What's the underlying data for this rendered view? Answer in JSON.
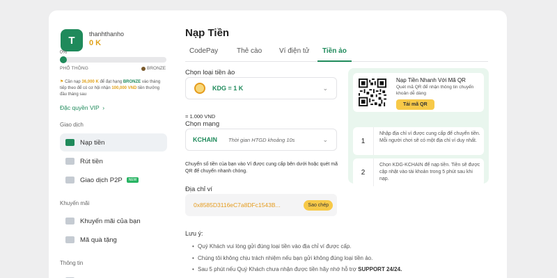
{
  "sidebar": {
    "avatar_letter": "T",
    "username": "thanhthanho",
    "balance": "0 K",
    "progress_label": "0%",
    "progress_value": 0,
    "rank_current": "PHỔ THÔNG",
    "rank_next": "BRONZE",
    "note": {
      "part1": "Cần nạp ",
      "amount": "36,000 K",
      "part2": " để đạt hạng ",
      "rank": "BRONZE",
      "part3": " vào tháng tiếp theo để có cơ hội nhận ",
      "reward": "100,000 VND",
      "part4": " tiền thưởng đầu tháng sau"
    },
    "vip_link": "Đặc quyền VIP",
    "sections": {
      "transactions": "Giao dịch",
      "promotions": "Khuyến mãi",
      "info": "Thông tin"
    },
    "items": {
      "deposit": "Nạp tiền",
      "withdraw": "Rút tiền",
      "p2p": "Giao dịch P2P",
      "p2p_badge": "NEW",
      "my_promos": "Khuyến mãi của bạn",
      "gift_code": "Mã quà tặng"
    }
  },
  "main": {
    "title": "Nạp Tiền",
    "tabs": [
      "CodePay",
      "Thẻ cào",
      "Ví điện tử",
      "Tiền ảo"
    ],
    "active_tab": "Tiền ảo",
    "currency_label": "Chọn loại tiền ảo",
    "currency_value": "KDG = 1 K",
    "rate": "= 1.000 VND",
    "network_label": "Chọn mạng",
    "network_value": "KCHAIN",
    "network_time": "Thời gian HTGD khoảng 10s",
    "instruction": "Chuyển số tiền của bạn vào Ví được cung cấp bên dưới hoặc quét mã QR để chuyển nhanh chóng.",
    "address_label": "Địa chỉ ví",
    "address_value": "0x8585D3116eC7a8DFc1543B...",
    "copy_label": "Sao chép",
    "notes_title": "Lưu ý:",
    "notes": [
      "Quý Khách vui lòng gửi đúng loại tiền vào địa chỉ ví được cấp.",
      "Chúng tôi không chịu trách nhiệm nếu bạn gửi không đúng loại tiền ảo.",
      "Sau 5 phút nếu Quý Khách chưa nhận được tiền hãy nhớ hỗ trợ "
    ],
    "support_text": "SUPPORT 24/24."
  },
  "qr_panel": {
    "title": "Nạp Tiền Nhanh Với Mã QR",
    "description": "Quét mã QR để nhận thông tin chuyển khoản dễ dàng",
    "download_label": "Tải mã QR",
    "steps": [
      {
        "num": "1",
        "text": "Nhập địa chỉ ví được cung cấp để chuyển tiền. Mỗi người chơi sẽ có một địa chỉ ví duy nhất."
      },
      {
        "num": "2",
        "text": "Chọn KDG-KCHAIN để nạp tiền. Tiền sẽ được cập nhật vào tài khoản trong 5 phút sau khi nạp."
      }
    ]
  },
  "colors": {
    "accent": "#1f8a5b",
    "gold": "#e0a21b",
    "button_yellow": "#f7c948",
    "panel_bg": "#e9f6ee"
  }
}
